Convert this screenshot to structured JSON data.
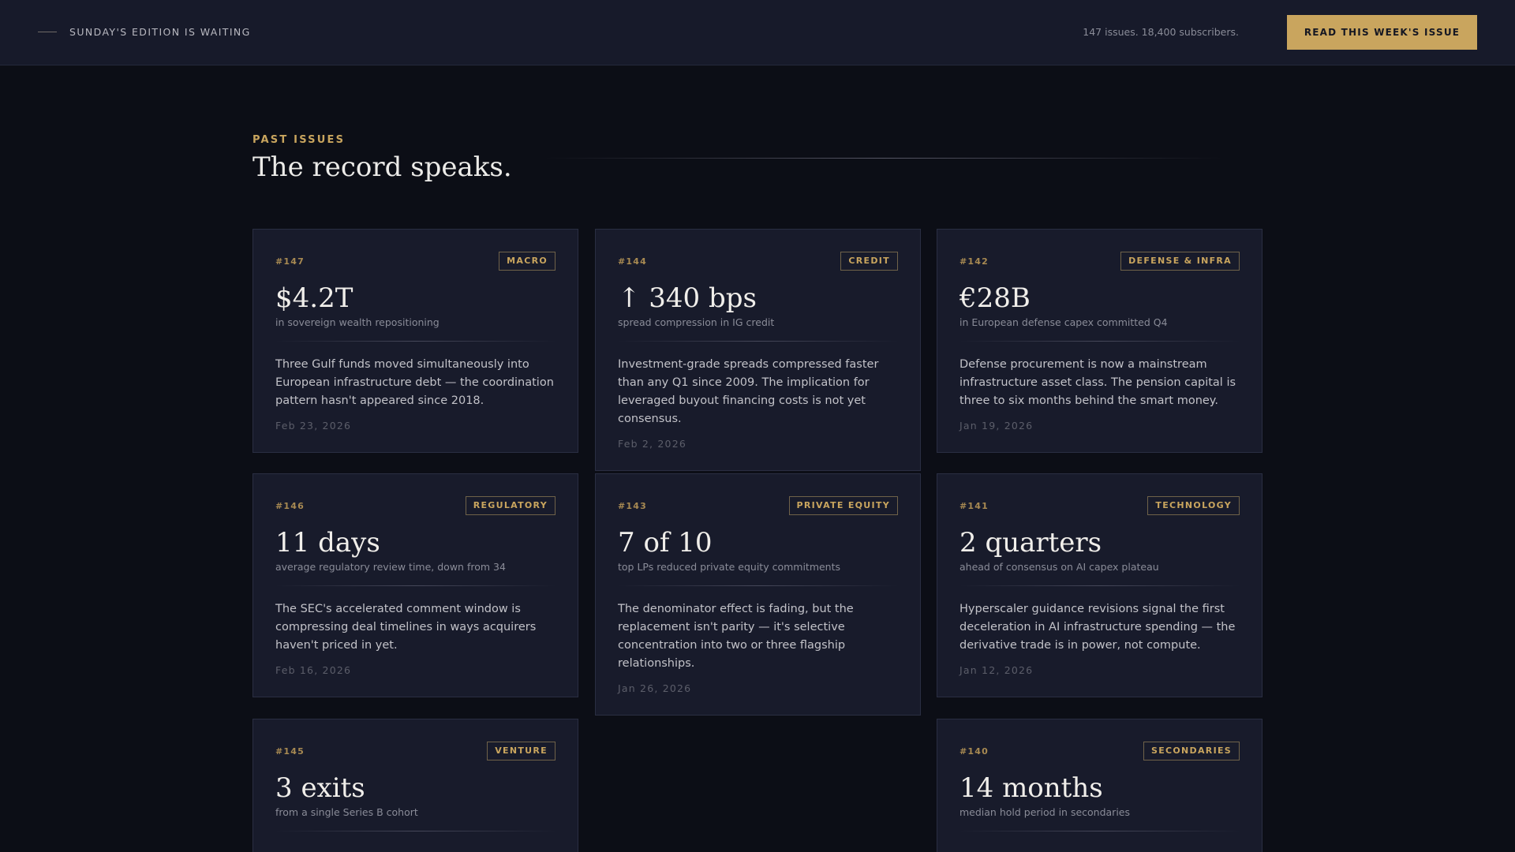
{
  "topbar": {
    "edition": "SUNDAY'S EDITION IS WAITING",
    "stats": "147 issues. 18,400 subscribers.",
    "cta_label": "READ THIS WEEK'S ISSUE"
  },
  "section": {
    "kicker": "PAST ISSUES",
    "title": "The record speaks."
  },
  "cards": [
    {
      "num": "#147",
      "tag": "MACRO",
      "value": "$4.2T",
      "sub": "in sovereign wealth repositioning",
      "body": "Three Gulf funds moved simultaneously into European infrastructure debt — the coordination pattern hasn't appeared since 2018.",
      "date": "Feb 23, 2026"
    },
    {
      "num": "#144",
      "tag": "CREDIT",
      "value": "↑ 340 bps",
      "sub": "spread compression in IG credit",
      "body": "Investment-grade spreads compressed faster than any Q1 since 2009. The implication for leveraged buyout financing costs is not yet consensus.",
      "date": "Feb 2, 2026"
    },
    {
      "num": "#142",
      "tag": "DEFENSE & INFRA",
      "value": "€28B",
      "sub": "in European defense capex committed Q4",
      "body": "Defense procurement is now a mainstream infrastructure asset class. The pension capital is three to six months behind the smart money.",
      "date": "Jan 19, 2026"
    },
    {
      "num": "#146",
      "tag": "REGULATORY",
      "value": "11 days",
      "sub": "average regulatory review time, down from 34",
      "body": "The SEC's accelerated comment window is compressing deal timelines in ways acquirers haven't priced in yet.",
      "date": "Feb 16, 2026"
    },
    {
      "num": "#143",
      "tag": "PRIVATE EQUITY",
      "value": "7 of 10",
      "sub": "top LPs reduced private equity commitments",
      "body": "The denominator effect is fading, but the replacement isn't parity — it's selective concentration into two or three flagship relationships.",
      "date": "Jan 26, 2026"
    },
    {
      "num": "#141",
      "tag": "TECHNOLOGY",
      "value": "2 quarters",
      "sub": "ahead of consensus on AI capex plateau",
      "body": "Hyperscaler guidance revisions signal the first deceleration in AI infrastructure spending — the derivative trade is in power, not compute.",
      "date": "Jan 12, 2026"
    },
    {
      "num": "#145",
      "tag": "VENTURE",
      "value": "3 exits",
      "sub": "from a single Series B cohort",
      "body": "",
      "date": ""
    },
    {
      "num": "#140",
      "tag": "SECONDARIES",
      "value": "14 months",
      "sub": "median hold period in secondaries",
      "body": "",
      "date": ""
    }
  ]
}
